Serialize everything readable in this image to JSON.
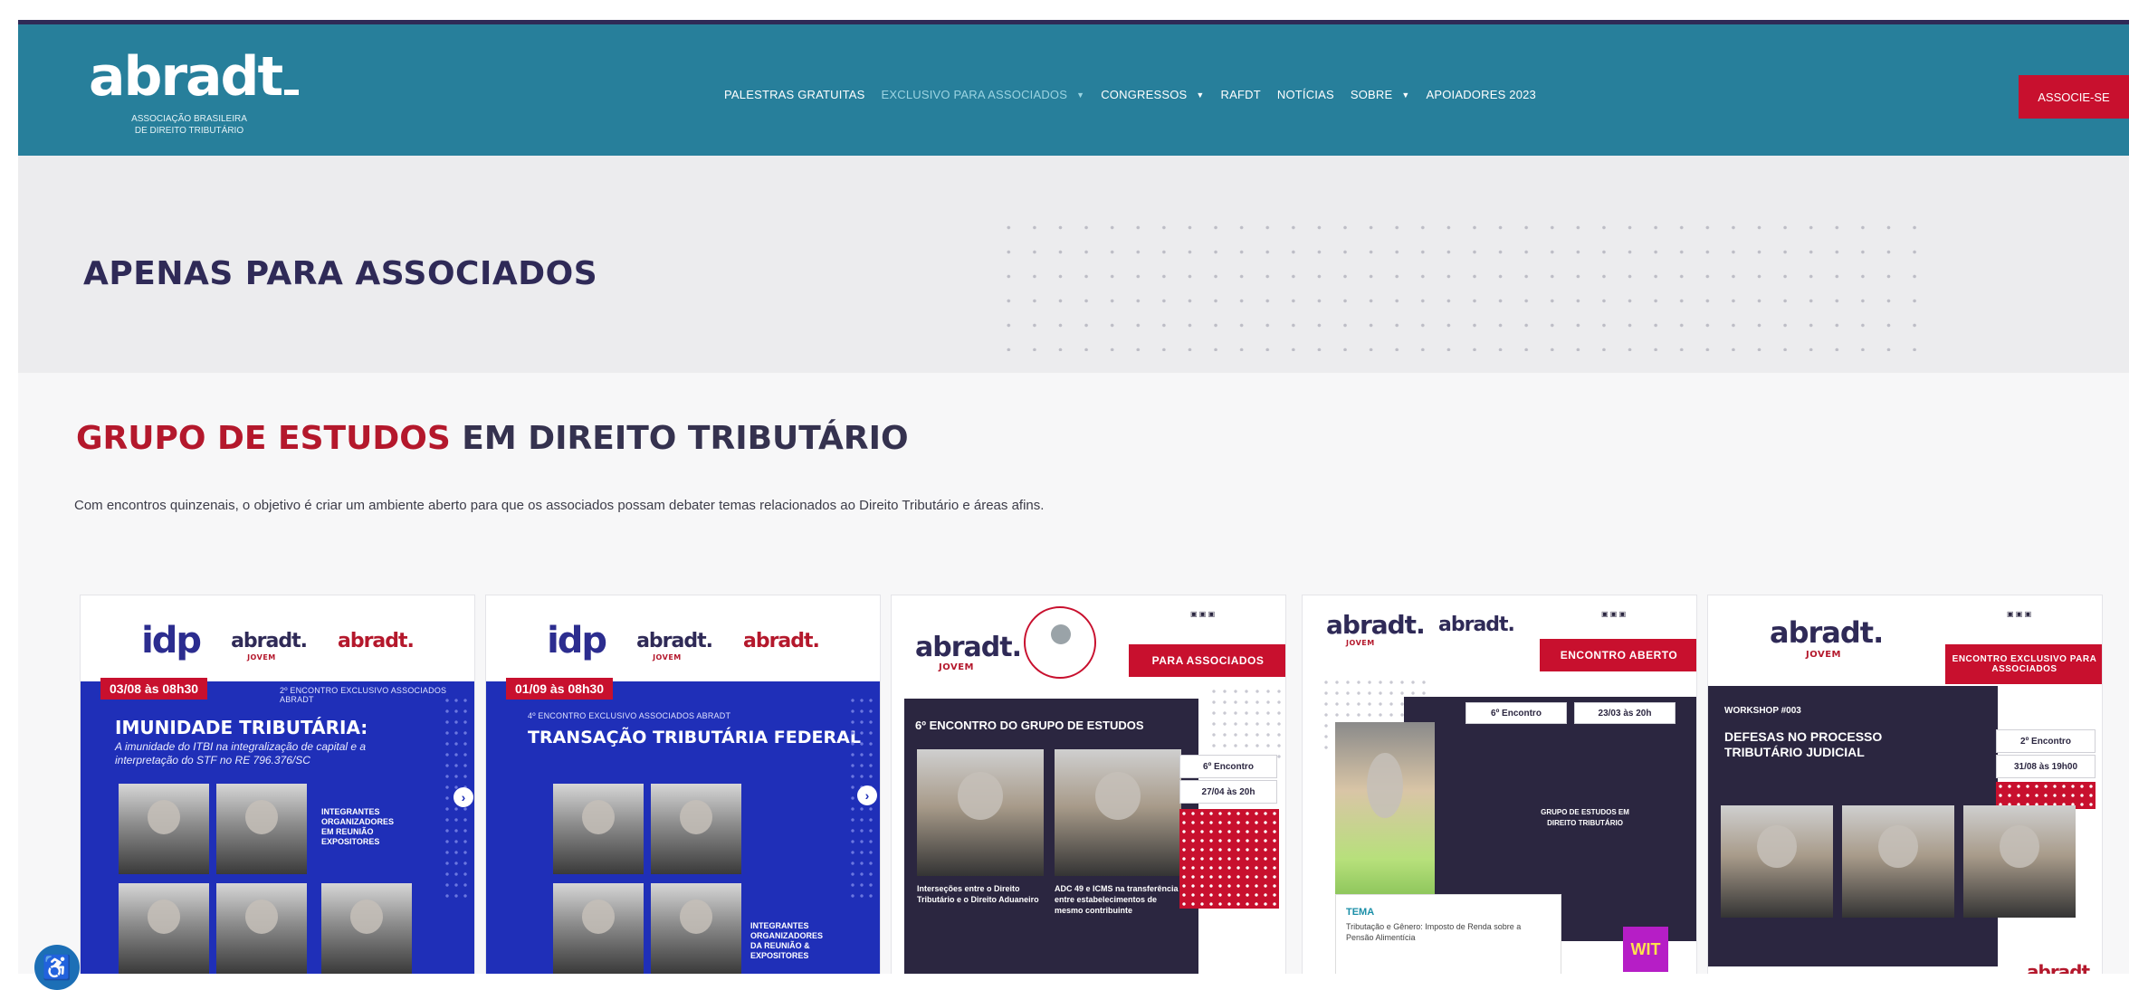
{
  "brand": {
    "logo_text": "abradt",
    "logo_subtitle": "ASSOCIAÇÃO BRASILEIRA\nDE DIREITO TRIBUTÁRIO"
  },
  "nav": {
    "items": [
      {
        "label": "PALESTRAS GRATUITAS"
      },
      {
        "label": "EXCLUSIVO PARA ASSOCIADOS"
      },
      {
        "label": "CONGRESSOS"
      },
      {
        "label": "RAFDT"
      },
      {
        "label": "NOTÍCIAS"
      },
      {
        "label": "SOBRE"
      },
      {
        "label": "APOIADORES 2023"
      }
    ],
    "cta_label": "ASSOCIE-SE"
  },
  "hero": {
    "title": "APENAS PARA ASSOCIADOS"
  },
  "section": {
    "title_accent": "GRUPO DE ESTUDOS",
    "title_rest": " EM DIREITO TRIBUTÁRIO",
    "description": "Com encontros quinzenais, o objetivo é criar um ambiente aberto para que os associados possam debater temas relacionados ao Direito Tributário e áreas afins."
  },
  "cards": [
    {
      "logo_idp": "idp",
      "logo_a": "abradt.",
      "logo_a_sub": "JOVEM",
      "logo_b": "abradt.",
      "date": "03/08 às 08h30",
      "subtitle": "2º ENCONTRO EXCLUSIVO ASSOCIADOS ABRADT",
      "title": "IMUNIDADE TRIBUTÁRIA:",
      "desc": "A imunidade do ITBI na integralização de capital e a interpretação do STF no RE 796.376/SC",
      "organizers": "INTEGRANTES ORGANIZADORES EM REUNIÃO EXPOSITORES"
    },
    {
      "logo_idp": "idp",
      "logo_a": "abradt.",
      "logo_a_sub": "JOVEM",
      "logo_b": "abradt.",
      "date": "01/09 às 08h30",
      "subtitle": "4º ENCONTRO EXCLUSIVO ASSOCIADOS ABRADT",
      "title": "TRANSAÇÃO TRIBUTÁRIA FEDERAL",
      "organizers": "INTEGRANTES ORGANIZADORES DA REUNIÃO & EXPOSITORES"
    },
    {
      "logo": "abradt.",
      "logo_sub": "JOVEM",
      "badge": "PARA ASSOCIADOS",
      "heading": "6º ENCONTRO DO GRUPO DE ESTUDOS",
      "encontro": "6º Encontro",
      "encontro_date": "27/04 às 20h",
      "topic_left": "Interseções entre o Direito Tributário e o Direito Aduaneiro",
      "topic_right": "ADC 49 e ICMS na transferência entre estabelecimentos de mesmo contribuinte"
    },
    {
      "logo_a": "abradt.",
      "logo_a_sub": "JOVEM",
      "logo_b": "abradt.",
      "badge": "ENCONTRO ABERTO",
      "encontro": "6º Encontro",
      "encontro_date": "23/03 às 20h",
      "circle_text": "GRUPO DE ESTUDOS EM DIREITO TRIBUTÁRIO",
      "tema_label": "TEMA",
      "tema_text": "Tributação e Gênero: Imposto de Renda sobre a Pensão Alimentícia",
      "wit": "WIT"
    },
    {
      "logo": "abradt.",
      "logo_sub": "JOVEM",
      "badge": "ENCONTRO EXCLUSIVO PARA ASSOCIADOS",
      "workshop": "WORKSHOP #003",
      "title": "DEFESAS NO PROCESSO TRIBUTÁRIO JUDICIAL",
      "encontro": "2º Encontro",
      "encontro_date": "31/08 às 19h00",
      "footer_logo": "abradt."
    }
  ],
  "colors": {
    "header_bg": "#277f9b",
    "navy": "#2f2a57",
    "accent_red": "#c8102e",
    "card_blue": "#1f2fb8"
  },
  "icons": {
    "accessibility": "accessibility-icon",
    "carousel_next": "arrow-right-icon"
  }
}
